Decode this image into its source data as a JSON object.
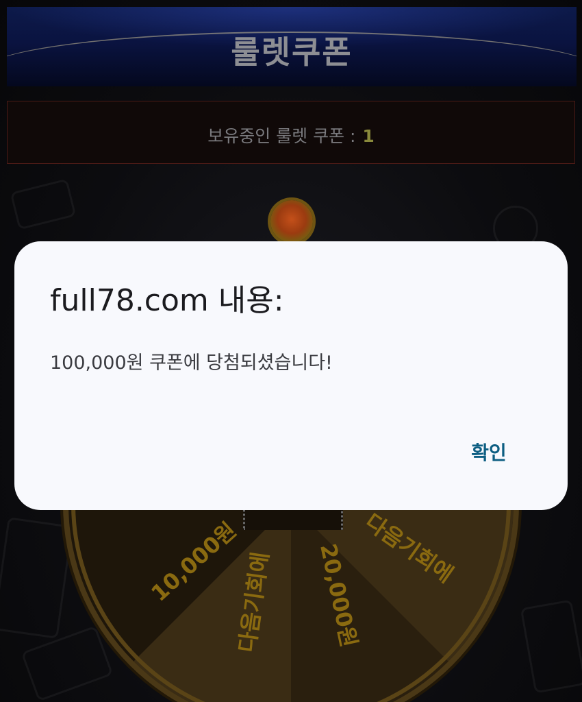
{
  "header": {
    "title": "룰렛쿠폰"
  },
  "coupon_status": {
    "label": "보유중인 룰렛 쿠폰 : ",
    "count": "1"
  },
  "roulette": {
    "segments": [
      {
        "label": "10,000원"
      },
      {
        "label": "다음기회에"
      },
      {
        "label": "20,000원"
      },
      {
        "label": "다음기회에"
      }
    ],
    "colors": {
      "segment_dark": "#1e160a",
      "segment_light": "#3a2c14",
      "label": "#8a6a10",
      "rim": "#4a3816"
    }
  },
  "dialog": {
    "title": "full78.com 내용:",
    "message": "100,000원 쿠폰에 당첨되셨습니다!",
    "ok_label": "확인"
  },
  "colors": {
    "dialog_background": "#f8f9fd",
    "ok_button_text": "#0d5e82",
    "header_background": "#0a1340"
  }
}
